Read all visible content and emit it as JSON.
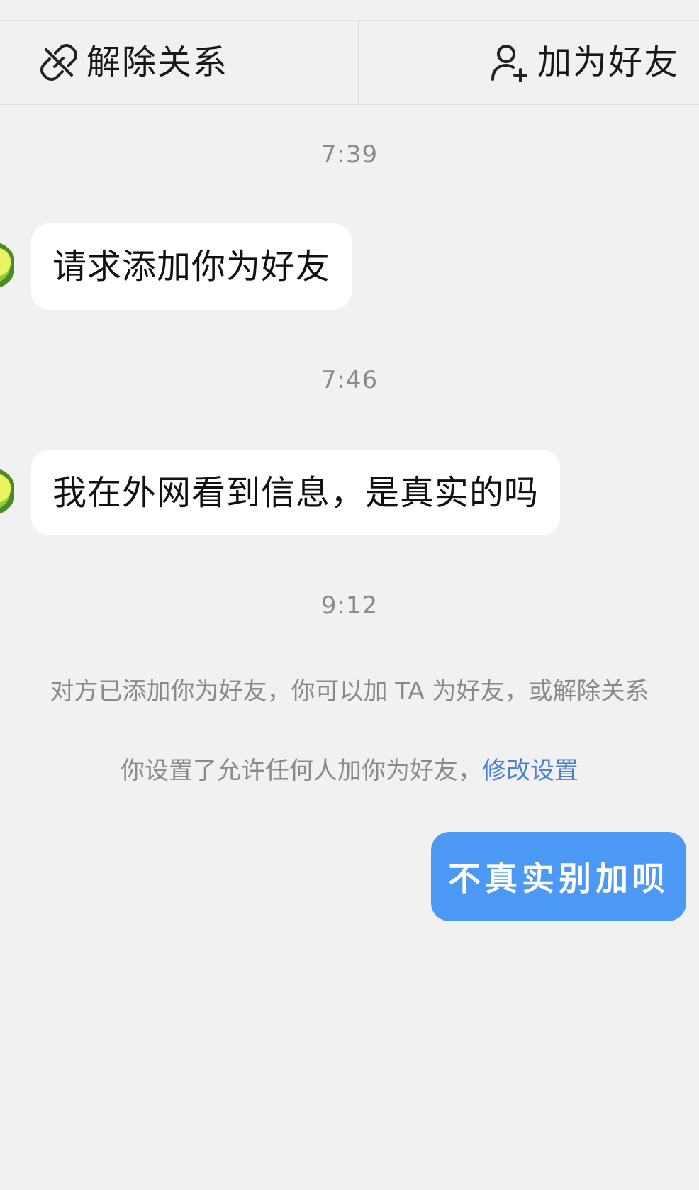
{
  "top_bar": {
    "remove_relation_label": "解除关系",
    "add_friend_label": "加为好友",
    "icons": {
      "remove_relation": "unlink-icon",
      "add_friend": "add-user-icon"
    }
  },
  "messages": [
    {
      "time": "7:39",
      "text": "请求添加你为好友",
      "direction": "incoming"
    },
    {
      "time": "7:46",
      "text": "我在外网看到信息，是真实的吗",
      "direction": "incoming"
    }
  ],
  "system": {
    "time": "9:12",
    "notice": "对方已添加你为好友，你可以加 TA 为好友，或解除关系",
    "settings_notice": "你设置了允许任何人加你为好友，",
    "settings_link": "修改设置"
  },
  "outgoing": {
    "text": "不真实别加呗"
  },
  "colors": {
    "background": "#f1f1f1",
    "incoming_bubble": "#ffffff",
    "outgoing_bubble": "#4b98f5",
    "link": "#4a7fd6",
    "muted_text": "#8a8a8a"
  }
}
